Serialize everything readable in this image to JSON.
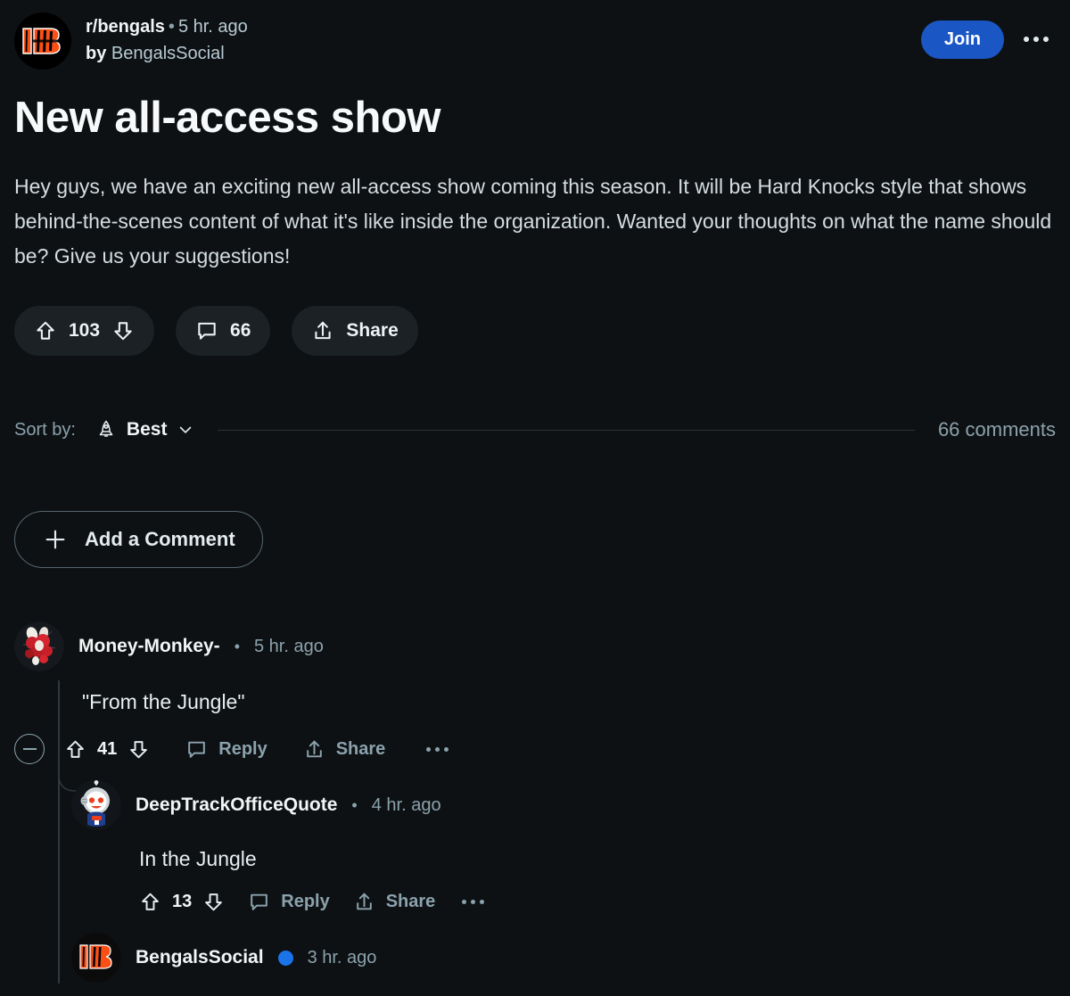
{
  "post": {
    "subreddit": "r/bengals",
    "separator": "•",
    "age": "5 hr. ago",
    "by_prefix": "by",
    "author": "BengalsSocial",
    "join_label": "Join",
    "overflow_label": "more-options",
    "title": "New all-access show",
    "body": "Hey guys, we have an exciting new all-access show coming this season. It will be Hard Knocks style that shows behind-the-scenes content of what it's like inside the organization. Wanted your thoughts on what the name should be? Give us your suggestions!",
    "actions": {
      "upvote_icon": "upvote-arrow-icon",
      "score": "103",
      "downvote_icon": "downvote-arrow-icon",
      "comment_icon": "comment-bubble-icon",
      "comment_count": "66",
      "share_icon": "share-arrow-icon",
      "share_label": "Share"
    }
  },
  "sort": {
    "label": "Sort by:",
    "icon": "rocket-icon",
    "value": "Best",
    "chevron": "chevron-down-icon",
    "comments_total": "66 comments"
  },
  "add_comment": {
    "icon": "plus-icon",
    "label": "Add a Comment"
  },
  "comments": [
    {
      "avatar": "money-monkey-avatar",
      "author": "Money-Monkey-",
      "separator": "•",
      "age": "5 hr. ago",
      "text": "\"From the Jungle\"",
      "collapse_icon": "collapse-minus-icon",
      "score": "41",
      "reply_label": "Reply",
      "share_label": "Share",
      "overflow": "more-options"
    },
    {
      "avatar": "astronaut-snoo-avatar",
      "author": "DeepTrackOfficeQuote",
      "separator": "•",
      "age": "4 hr. ago",
      "text": "In the Jungle",
      "score": "13",
      "reply_label": "Reply",
      "share_label": "Share",
      "overflow": "more-options"
    },
    {
      "avatar": "bengals-logo-avatar",
      "author": "BengalsSocial",
      "verified": true,
      "separator": "•",
      "age": "3 hr. ago"
    }
  ],
  "colors": {
    "background": "#0e1113",
    "join_blue": "#1a56c4",
    "pill_bg": "#1b2124",
    "text_primary": "#f2f4f5",
    "text_muted": "#8ba2ad",
    "verified_blue": "#1a73e8"
  }
}
